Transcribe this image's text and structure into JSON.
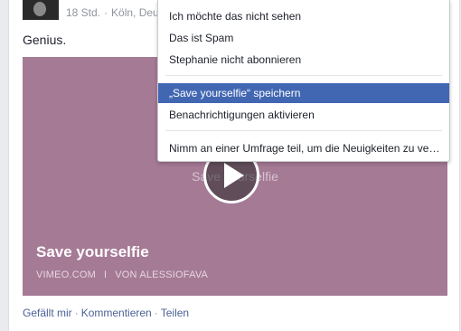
{
  "post": {
    "time": "18 Std.",
    "separator": "·",
    "location": "Köln, Deut",
    "text": "Genius."
  },
  "video": {
    "overlay_title": "Save yourselfie",
    "title": "Save yourselfie",
    "source": "VIMEO.COM",
    "divider": "I",
    "author": "VON ALESSIOFAVA",
    "bg_color": "#a57a95"
  },
  "actions": {
    "like": "Gefällt mir",
    "comment": "Kommentieren",
    "share": "Teilen",
    "dot": "·"
  },
  "menu": {
    "items": [
      "Ich möchte das nicht sehen",
      "Das ist Spam",
      "Stephanie nicht abonnieren",
      "„Save yourselfie“ speichern",
      "Benachrichtigungen aktivieren",
      "Nimm an einer Umfrage teil, um die Neuigkeiten zu ve…"
    ],
    "highlight_color": "#4267b2"
  }
}
